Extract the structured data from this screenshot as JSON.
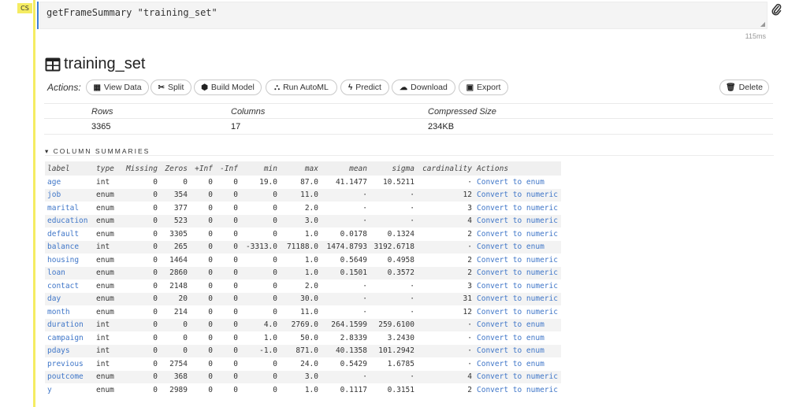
{
  "cell": {
    "tag": "CS",
    "code": "getFrameSummary \"training_set\"",
    "timing": "115ms"
  },
  "frame": {
    "title": "training_set",
    "actions_label": "Actions:",
    "buttons": [
      {
        "label": "View Data",
        "icon": "grid-icon"
      },
      {
        "label": "Split",
        "icon": "scissors-icon"
      },
      {
        "label": "Build Model",
        "icon": "cube-icon"
      },
      {
        "label": "Run AutoML",
        "icon": "sitemap-icon"
      },
      {
        "label": "Predict",
        "icon": "bolt-icon"
      },
      {
        "label": "Download",
        "icon": "cloud-download-icon"
      },
      {
        "label": "Export",
        "icon": "save-icon"
      }
    ],
    "delete_label": "Delete"
  },
  "stats": {
    "headers": [
      "Rows",
      "Columns",
      "Compressed Size"
    ],
    "values": [
      "3365",
      "17",
      "234KB"
    ]
  },
  "section_title": "COLUMN SUMMARIES",
  "columns_table": {
    "headers": [
      "label",
      "type",
      "Missing",
      "Zeros",
      "+Inf",
      "-Inf",
      "min",
      "max",
      "mean",
      "sigma",
      "cardinality",
      "Actions"
    ],
    "rows": [
      [
        "age",
        "int",
        "0",
        "0",
        "0",
        "0",
        "19.0",
        "87.0",
        "41.1477",
        "10.5211",
        "·",
        "Convert to enum"
      ],
      [
        "job",
        "enum",
        "0",
        "354",
        "0",
        "0",
        "0",
        "11.0",
        "·",
        "·",
        "12",
        "Convert to numeric"
      ],
      [
        "marital",
        "enum",
        "0",
        "377",
        "0",
        "0",
        "0",
        "2.0",
        "·",
        "·",
        "3",
        "Convert to numeric"
      ],
      [
        "education",
        "enum",
        "0",
        "523",
        "0",
        "0",
        "0",
        "3.0",
        "·",
        "·",
        "4",
        "Convert to numeric"
      ],
      [
        "default",
        "enum",
        "0",
        "3305",
        "0",
        "0",
        "0",
        "1.0",
        "0.0178",
        "0.1324",
        "2",
        "Convert to numeric"
      ],
      [
        "balance",
        "int",
        "0",
        "265",
        "0",
        "0",
        "-3313.0",
        "71188.0",
        "1474.8793",
        "3192.6718",
        "·",
        "Convert to enum"
      ],
      [
        "housing",
        "enum",
        "0",
        "1464",
        "0",
        "0",
        "0",
        "1.0",
        "0.5649",
        "0.4958",
        "2",
        "Convert to numeric"
      ],
      [
        "loan",
        "enum",
        "0",
        "2860",
        "0",
        "0",
        "0",
        "1.0",
        "0.1501",
        "0.3572",
        "2",
        "Convert to numeric"
      ],
      [
        "contact",
        "enum",
        "0",
        "2148",
        "0",
        "0",
        "0",
        "2.0",
        "·",
        "·",
        "3",
        "Convert to numeric"
      ],
      [
        "day",
        "enum",
        "0",
        "20",
        "0",
        "0",
        "0",
        "30.0",
        "·",
        "·",
        "31",
        "Convert to numeric"
      ],
      [
        "month",
        "enum",
        "0",
        "214",
        "0",
        "0",
        "0",
        "11.0",
        "·",
        "·",
        "12",
        "Convert to numeric"
      ],
      [
        "duration",
        "int",
        "0",
        "0",
        "0",
        "0",
        "4.0",
        "2769.0",
        "264.1599",
        "259.6100",
        "·",
        "Convert to enum"
      ],
      [
        "campaign",
        "int",
        "0",
        "0",
        "0",
        "0",
        "1.0",
        "50.0",
        "2.8339",
        "3.2430",
        "·",
        "Convert to enum"
      ],
      [
        "pdays",
        "int",
        "0",
        "0",
        "0",
        "0",
        "-1.0",
        "871.0",
        "40.1358",
        "101.2942",
        "·",
        "Convert to enum"
      ],
      [
        "previous",
        "int",
        "0",
        "2754",
        "0",
        "0",
        "0",
        "24.0",
        "0.5429",
        "1.6785",
        "·",
        "Convert to enum"
      ],
      [
        "poutcome",
        "enum",
        "0",
        "368",
        "0",
        "0",
        "0",
        "3.0",
        "·",
        "·",
        "4",
        "Convert to numeric"
      ],
      [
        "y",
        "enum",
        "0",
        "2989",
        "0",
        "0",
        "0",
        "1.0",
        "0.1117",
        "0.3151",
        "2",
        "Convert to numeric"
      ]
    ]
  },
  "colors": {
    "cell_marker": "#f5ec62",
    "link": "#3f76c8",
    "active_bar": "#3b7dd8"
  }
}
